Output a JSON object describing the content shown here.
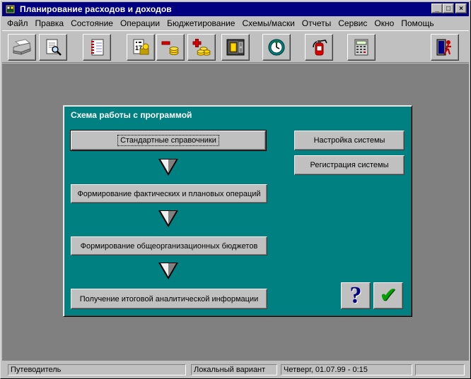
{
  "window": {
    "title": "Планирование расходов и доходов",
    "minimize_glyph": "_",
    "maximize_glyph": "□",
    "close_glyph": "×"
  },
  "menu": [
    {
      "label": "Файл",
      "name": "menu-file"
    },
    {
      "label": "Правка",
      "name": "menu-edit"
    },
    {
      "label": "Состояние",
      "name": "menu-state"
    },
    {
      "label": "Операции",
      "name": "menu-operations"
    },
    {
      "label": "Бюджетирование",
      "name": "menu-budgeting"
    },
    {
      "label": "Схемы/маски",
      "name": "menu-schemes"
    },
    {
      "label": "Отчеты",
      "name": "menu-reports"
    },
    {
      "label": "Сервис",
      "name": "menu-service"
    },
    {
      "label": "Окно",
      "name": "menu-window"
    },
    {
      "label": "Помощь",
      "name": "menu-help"
    }
  ],
  "toolbar": {
    "buttons": [
      {
        "name": "print-icon"
      },
      {
        "name": "preview-icon"
      },
      {
        "name": "register-icon"
      },
      {
        "name": "report-icon"
      },
      {
        "name": "expense-icon"
      },
      {
        "name": "income-icon"
      },
      {
        "name": "safe-icon"
      },
      {
        "name": "clock-icon"
      },
      {
        "name": "fire-extinguisher-icon"
      },
      {
        "name": "calculator-icon"
      },
      {
        "name": "exit-icon"
      }
    ]
  },
  "scheme": {
    "title": "Схема работы с программой",
    "steps": [
      "Стандартные справочники",
      "Формирование фактических и плановых операций",
      "Формирование общеорганизационных бюджетов",
      "Получение итоговой аналитической информации"
    ],
    "settings_button": "Настройка системы",
    "registration_button": "Регистрация системы",
    "help_glyph": "?",
    "ok_glyph": "✔"
  },
  "status": {
    "mode": "Путеводитель",
    "variant": "Локальный вариант",
    "datetime": "Четверг, 01.07.99 -  0:15",
    "extra": ""
  },
  "colors": {
    "title_bar": "#000080",
    "dialog_background": "#008080",
    "workspace": "#808080",
    "face": "#c0c0c0"
  }
}
